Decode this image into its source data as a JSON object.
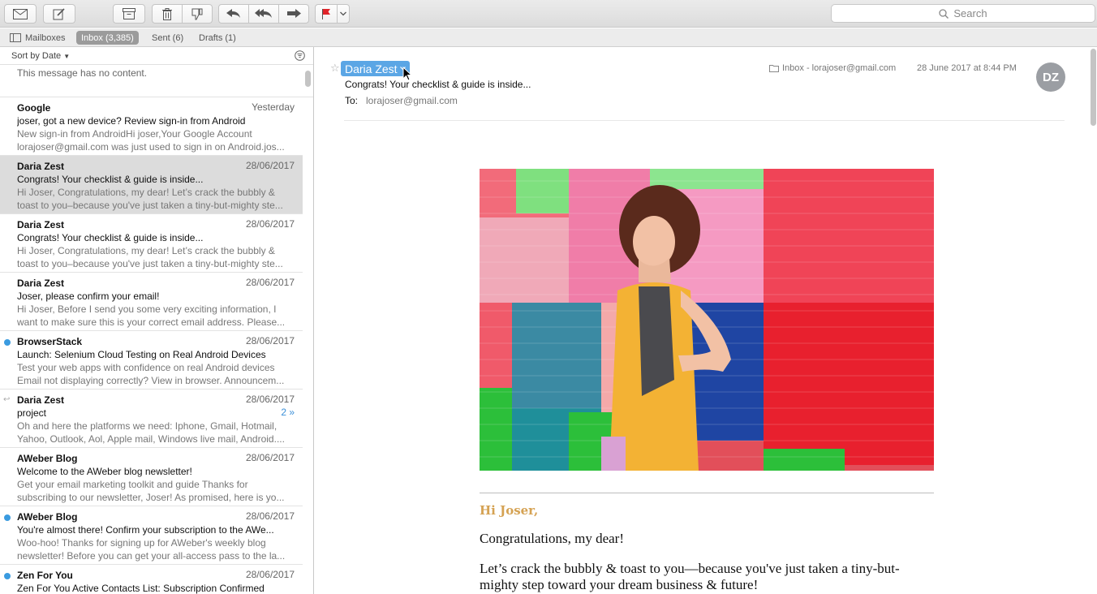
{
  "toolbar": {
    "buttons": [
      "mail-get-icon",
      "compose-icon",
      "archive-icon",
      "trash-icon",
      "junk-icon",
      "reply-icon",
      "reply-all-icon",
      "forward-icon",
      "flag-icon",
      "flag-menu-icon"
    ],
    "search_placeholder": "Search",
    "flag_color": "#e0242a"
  },
  "favorites": {
    "mailboxes": "Mailboxes",
    "inbox": "Inbox (3,385)",
    "sent": "Sent (6)",
    "drafts": "Drafts (1)"
  },
  "list": {
    "sort_label": "Sort by Date",
    "no_content": "This message has no content.",
    "messages": [
      {
        "from": "Google",
        "date": "Yesterday",
        "subject": "joser, got a new device? Review sign-in from Android",
        "preview": "New sign-in from AndroidHi joser,Your Google Account lorajoser@gmail.com was just used to sign in on Android.jos...",
        "unread": false,
        "selected": false
      },
      {
        "from": "Daria Zest",
        "date": "28/06/2017",
        "subject": "Congrats! Your checklist & guide is inside...",
        "preview": "Hi Joser, Congratulations, my dear! Let’s crack the bubbly & toast to you–because you've just taken a tiny-but-mighty ste...",
        "unread": false,
        "selected": true
      },
      {
        "from": "Daria Zest",
        "date": "28/06/2017",
        "subject": "Congrats! Your checklist & guide is inside...",
        "preview": "Hi Joser, Congratulations, my dear! Let’s crack the bubbly & toast to you–because you've just taken a tiny-but-mighty ste...",
        "unread": false,
        "selected": false
      },
      {
        "from": "Daria Zest",
        "date": "28/06/2017",
        "subject": "Joser, please confirm your email!",
        "preview": "Hi Joser, Before I send you some very exciting information, I want to make sure this is your correct email address. Please...",
        "unread": false,
        "selected": false
      },
      {
        "from": "BrowserStack",
        "date": "28/06/2017",
        "subject": "Launch: Selenium Cloud Testing on Real Android Devices",
        "preview": "Test your web apps with confidence on real Android devices Email not displaying correctly? View in browser. Announcem...",
        "unread": true,
        "selected": false
      },
      {
        "from": "Daria Zest",
        "date": "28/06/2017",
        "subject": "project",
        "preview": "Oh and here the platforms we need: Iphone, Gmail, Hotmail, Yahoo, Outlook, Aol, Apple mail, Windows live mail, Android....",
        "unread": false,
        "selected": false,
        "replied": true,
        "thread": "2 »"
      },
      {
        "from": "AWeber Blog",
        "date": "28/06/2017",
        "subject": "Welcome to the AWeber blog newsletter!",
        "preview": "Get your email marketing toolkit and guide Thanks for subscribing to our newsletter, Joser! As promised, here is yo...",
        "unread": false,
        "selected": false
      },
      {
        "from": "AWeber Blog",
        "date": "28/06/2017",
        "subject": "You're almost there! Confirm your subscription to the AWe...",
        "preview": "Woo-hoo! Thanks for signing up for AWeber's weekly blog newsletter! Before you can get your all-access pass to the la...",
        "unread": true,
        "selected": false
      },
      {
        "from": "Zen For You",
        "date": "28/06/2017",
        "subject": "Zen For You Active Contacts List: Subscription Confirmed",
        "preview": "",
        "unread": true,
        "selected": false
      }
    ]
  },
  "reader": {
    "from": "Daria Zest",
    "subject": "Congrats! Your checklist & guide is inside...",
    "to_label": "To:",
    "to_value": "lorajoser@gmail.com",
    "mailbox": "Inbox - lorajoser@gmail.com",
    "date": "28 June 2017 at 8:44 PM",
    "avatar_initials": "DZ",
    "greeting": "Hi Joser,",
    "para1": "Congratulations, my dear!",
    "para2": "Let’s crack the bubbly & toast to you—because you've just taken a tiny-but-mighty step toward your dream business & future!",
    "greeting_color": "#d5a253",
    "accent_color": "#5ba6e5"
  }
}
